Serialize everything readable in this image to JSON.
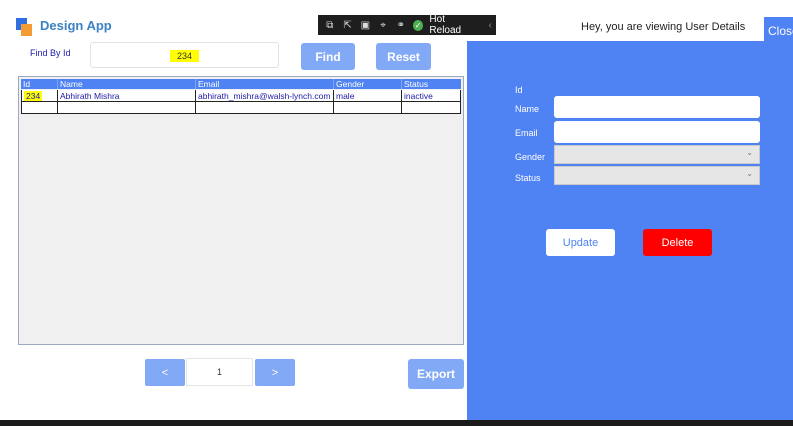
{
  "app": {
    "title": "Design App"
  },
  "debug_toolbar": {
    "hot_reload_label": "Hot Reload"
  },
  "header": {
    "message": "Hey, you are viewing User Details",
    "close_label": "Close"
  },
  "search": {
    "label": "Find By Id",
    "value": "234",
    "find_label": "Find",
    "reset_label": "Reset"
  },
  "grid": {
    "columns": [
      "Id",
      "Name",
      "Email",
      "Gender",
      "Status"
    ],
    "rows": [
      {
        "id": "234",
        "name": "Abhirath Mishra",
        "email": "abhirath_mishra@walsh-lynch.com",
        "gender": "male",
        "status": "inactive"
      }
    ]
  },
  "pager": {
    "prev": "<",
    "page": "1",
    "next": ">",
    "export_label": "Export"
  },
  "details": {
    "id_label": "Id",
    "name_label": "Name",
    "email_label": "Email",
    "gender_label": "Gender",
    "status_label": "Status",
    "update_label": "Update",
    "delete_label": "Delete"
  },
  "colors": {
    "accent": "#4f82f2",
    "button_light": "#82a9f5",
    "danger": "#ff0000",
    "highlight": "#ffff00"
  }
}
